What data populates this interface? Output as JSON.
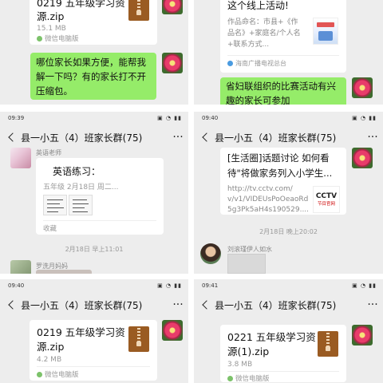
{
  "chat_title": "县一小五（4）班家长群(75)",
  "status": {
    "p3_time": "09:39",
    "p4_time": "09:40",
    "p5_time": "09:40",
    "p6_time": "09:41",
    "net": "HD"
  },
  "panel1": {
    "file_name_line1": "0219 五年级学习资",
    "file_name_line2": "源.zip",
    "file_size": "15.1 MB",
    "file_source": "微信电脑版",
    "message_line1": "哪位家长如果方便，能帮我",
    "message_line2": "解一下吗？有的家长打不开",
    "message_line3": "压缩包。"
  },
  "panel2": {
    "top_text": "这个线上活动!",
    "desc_line1": "作品命名：市县+《作",
    "desc_line2": "品名》+家庭名/个人名",
    "desc_line3": "+联系方式...",
    "source": "海南广播电视总台",
    "message_line1": "省妇联组织的比赛活动有兴",
    "message_line2": "趣的家长可参加"
  },
  "panel3": {
    "sender": "英语老师",
    "title": "英语练习：",
    "meta": "五年级  2月18日 周二...",
    "footer": "收藏",
    "timestamp": "2月18日 早上11:01",
    "next_sender": "罗洗月妈妈"
  },
  "panel4": {
    "link_line1": "[生活圈]话题讨论 如何看",
    "link_line2": "待\"将做家务列入小学生...",
    "url_line1": "http://tv.cctv.com/",
    "url_line2": "v/v1/VIDEUsPoOeaoRd",
    "url_line3": "5g3Pk5aH4s190529....",
    "thumb_line1": "CCTV",
    "thumb_line2": "节目官网",
    "timestamp": "2月18日 晚上20:02",
    "next_sender": "刘滚瑾伊人如水"
  },
  "panel5": {
    "file_name_line1": "0219 五年级学习资",
    "file_name_line2": "源.zip",
    "file_size": "4.2 MB",
    "file_source": "微信电脑版"
  },
  "panel6": {
    "file_name_line1": "0221 五年级学习资",
    "file_name_line2": "源(1).zip",
    "file_size": "3.8 MB",
    "file_source": "微信电脑版"
  }
}
